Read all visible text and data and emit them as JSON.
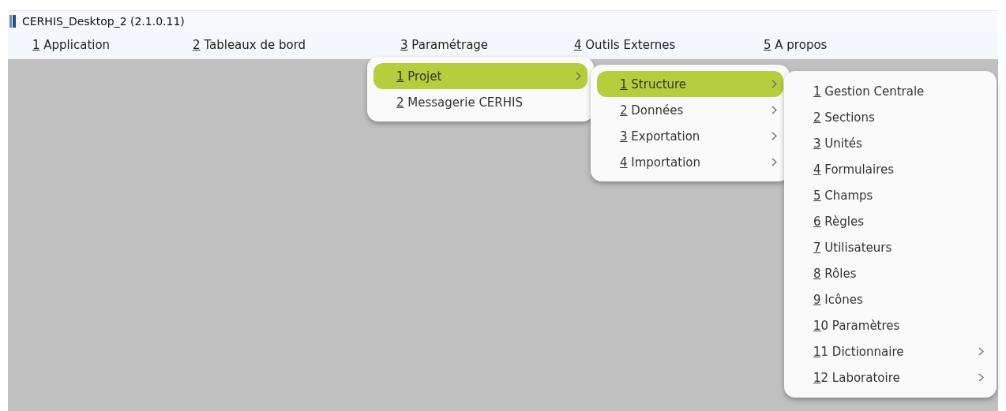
{
  "window": {
    "title": "CERHIS_Desktop_2 (2.1.0.11)"
  },
  "menubar": [
    {
      "label": "1 Application"
    },
    {
      "label": "2 Tableaux de bord"
    },
    {
      "label": "3 Paramétrage"
    },
    {
      "label": "4 Outils Externes"
    },
    {
      "label": "5 A propos"
    }
  ],
  "menus": [
    {
      "items": [
        {
          "label": "1 Projet",
          "selected": true,
          "has_submenu": true
        },
        {
          "label": "2 Messagerie CERHIS",
          "selected": false,
          "has_submenu": false
        }
      ]
    },
    {
      "items": [
        {
          "label": "1 Structure",
          "selected": true,
          "has_submenu": true
        },
        {
          "label": "2 Données",
          "selected": false,
          "has_submenu": true
        },
        {
          "label": "3 Exportation",
          "selected": false,
          "has_submenu": true
        },
        {
          "label": "4 Importation",
          "selected": false,
          "has_submenu": true
        }
      ]
    },
    {
      "items": [
        {
          "label": "1 Gestion Centrale",
          "selected": false,
          "has_submenu": false
        },
        {
          "label": "2 Sections",
          "selected": false,
          "has_submenu": false
        },
        {
          "label": "3 Unités",
          "selected": false,
          "has_submenu": false
        },
        {
          "label": "4 Formulaires",
          "selected": false,
          "has_submenu": false
        },
        {
          "label": "5 Champs",
          "selected": false,
          "has_submenu": false
        },
        {
          "label": "6 Règles",
          "selected": false,
          "has_submenu": false
        },
        {
          "label": "7 Utilisateurs",
          "selected": false,
          "has_submenu": false
        },
        {
          "label": "8 Rôles",
          "selected": false,
          "has_submenu": false
        },
        {
          "label": "9 Icônes",
          "selected": false,
          "has_submenu": false
        },
        {
          "label": "10 Paramètres",
          "selected": false,
          "has_submenu": false
        },
        {
          "label": "11 Dictionnaire",
          "selected": false,
          "has_submenu": true
        },
        {
          "label": "12 Laboratoire",
          "selected": false,
          "has_submenu": true
        }
      ]
    }
  ]
}
